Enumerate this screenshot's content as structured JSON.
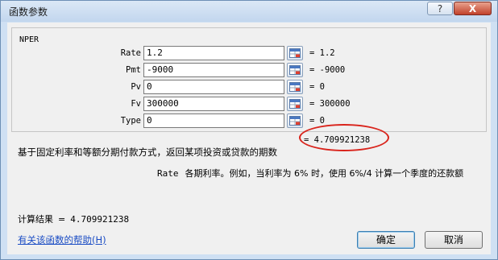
{
  "window": {
    "title": "函数参数",
    "help_label": "?",
    "close_label": "X"
  },
  "function_name": "NPER",
  "params": [
    {
      "label": "Rate",
      "value": "1.2",
      "result": "=  1.2"
    },
    {
      "label": "Pmt",
      "value": "-9000",
      "result": "=  -9000"
    },
    {
      "label": "Pv",
      "value": "0",
      "result": "=  0"
    },
    {
      "label": "Fv",
      "value": "300000",
      "result": "=  300000"
    },
    {
      "label": "Type",
      "value": "0",
      "result": "=  0"
    }
  ],
  "formula_result": "=  4.709921238",
  "description": "基于固定利率和等额分期付款方式，返回某项投资或贷款的期数",
  "arg_description": {
    "name": "Rate",
    "text": "各期利率。例如，当利率为 6% 时，使用 6%/4 计算一个季度的还款额"
  },
  "calc_result": {
    "label": "计算结果",
    "eq": "=",
    "value": "4.709921238"
  },
  "help_link": "有关该函数的帮助(H)",
  "buttons": {
    "ok": "确定",
    "cancel": "取消"
  },
  "colors": {
    "highlight_oval": "#d9241c",
    "link": "#1a4cc4"
  }
}
